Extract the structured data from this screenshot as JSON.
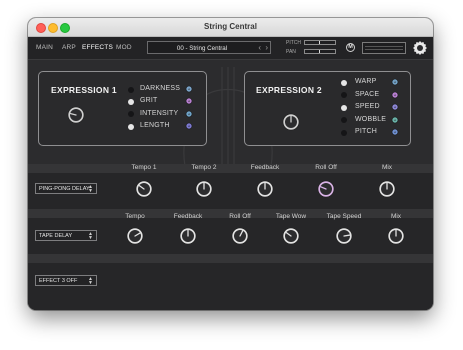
{
  "window": {
    "title": "String Central"
  },
  "nav": {
    "items": [
      "MAIN",
      "ARP",
      "EFFECTS",
      "MOD"
    ],
    "active": "EFFECTS"
  },
  "preset": {
    "name": "00 - String Central",
    "prev": "‹",
    "next": "›"
  },
  "header": {
    "pitch_label": "PITCH",
    "pan_label": "PAN",
    "m_label": "M"
  },
  "expression1": {
    "title": "EXPRESSION 1",
    "options": [
      {
        "label": "DARKNESS",
        "active": false,
        "accent": "#7aa3c8"
      },
      {
        "label": "GRIT",
        "active": true,
        "accent": "#b77fd0"
      },
      {
        "label": "INTENSITY",
        "active": false,
        "accent": "#6fa3c8"
      },
      {
        "label": "LENGTH",
        "active": true,
        "accent": "#7b78cf"
      }
    ]
  },
  "expression2": {
    "title": "EXPRESSION 2",
    "options": [
      {
        "label": "WARP",
        "active": true,
        "accent": "#72a0c4"
      },
      {
        "label": "SPACE",
        "active": false,
        "accent": "#b77fd0"
      },
      {
        "label": "SPEED",
        "active": true,
        "accent": "#8c86d6"
      },
      {
        "label": "WOBBLE",
        "active": false,
        "accent": "#69b2a8"
      },
      {
        "label": "PITCH",
        "active": false,
        "accent": "#6e8fd0"
      }
    ]
  },
  "effects": {
    "slot1": {
      "name": "PING-PONG DELAY",
      "params": [
        {
          "label": "Tempo 1",
          "value": 0.3,
          "highlight": false
        },
        {
          "label": "Tempo 2",
          "value": 0.5,
          "highlight": false
        },
        {
          "label": "Feedback",
          "value": 0.5,
          "highlight": false
        },
        {
          "label": "Roll Off",
          "value": 0.25,
          "highlight": true
        },
        {
          "label": "Mix",
          "value": 0.5,
          "highlight": false
        }
      ]
    },
    "slot2": {
      "name": "TAPE DELAY",
      "params": [
        {
          "label": "Tempo",
          "value": 0.72,
          "highlight": false
        },
        {
          "label": "Feedback",
          "value": 0.5,
          "highlight": false
        },
        {
          "label": "Roll Off",
          "value": 0.6,
          "highlight": false
        },
        {
          "label": "Tape Wow",
          "value": 0.3,
          "highlight": false
        },
        {
          "label": "Tape Speed",
          "value": 0.8,
          "highlight": false
        },
        {
          "label": "Mix",
          "value": 0.5,
          "highlight": false
        }
      ]
    },
    "slot3": {
      "name": "EFFECT 3 OFF"
    }
  },
  "colors": {
    "highlight_knob": "#d9b3e6",
    "accent": "#b77fd0",
    "background": "#2c2c2e"
  }
}
